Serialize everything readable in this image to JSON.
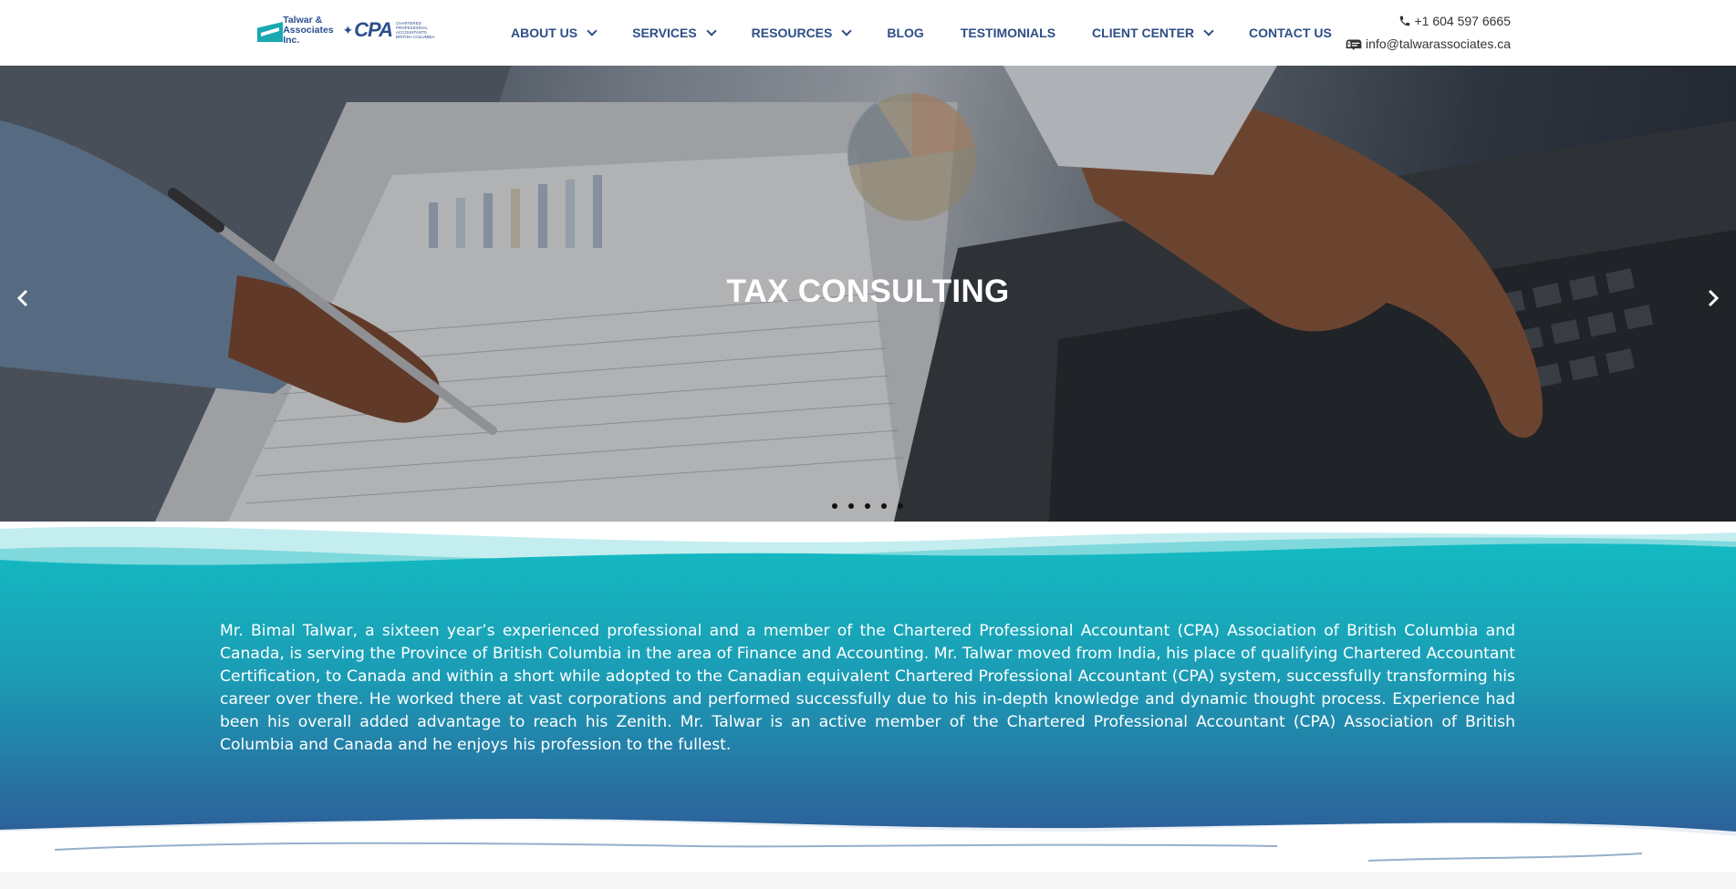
{
  "header": {
    "logo": {
      "firm_name": "Talwar & Associates Inc.",
      "cpa_mark": "CPA",
      "cpa_sub": "Chartered Professional Accountants British Columbia"
    },
    "nav": [
      {
        "label": "ABOUT US",
        "has_dropdown": true
      },
      {
        "label": "SERVICES",
        "has_dropdown": true
      },
      {
        "label": "RESOURCES",
        "has_dropdown": true
      },
      {
        "label": "BLOG",
        "has_dropdown": false
      },
      {
        "label": "TESTIMONIALS",
        "has_dropdown": false
      },
      {
        "label": "CLIENT CENTER",
        "has_dropdown": true
      },
      {
        "label": "CONTACT US",
        "has_dropdown": false
      }
    ],
    "contact": {
      "phone": "+1 604 597 6665",
      "phone_icon": "phone-icon",
      "email": "info@talwarassociates.ca",
      "email_icon": "mailbox-icon"
    }
  },
  "hero": {
    "title": "TAX CONSULTING",
    "prev_icon": "chevron-left-icon",
    "next_icon": "chevron-right-icon",
    "slides_count": 5,
    "active_slide": 3
  },
  "about": {
    "text": "Mr. Bimal Talwar, a sixteen year’s experienced professional and a member of the Chartered Professional Accountant (CPA) Association of British Columbia and Canada,  is serving the Province of British Columbia in the area of Finance and Accounting. Mr. Talwar moved from India, his place of qualifying Chartered Accountant Certification, to Canada and within a short while adopted to the Canadian equivalent Chartered Professional Accountant (CPA) system, successfully transforming his career over there. He worked there at vast corporations and performed successfully due to his in-depth knowledge and dynamic thought process. Experience had been his overall added advantage to reach his Zenith. Mr. Talwar is an active member of the Chartered Professional Accountant (CPA) Association of British Columbia and Canada and he enjoys his profession to the fullest."
  },
  "colors": {
    "nav_text": "#2d4e86",
    "teal": "#14bac2",
    "deep_blue": "#2b5f97"
  }
}
